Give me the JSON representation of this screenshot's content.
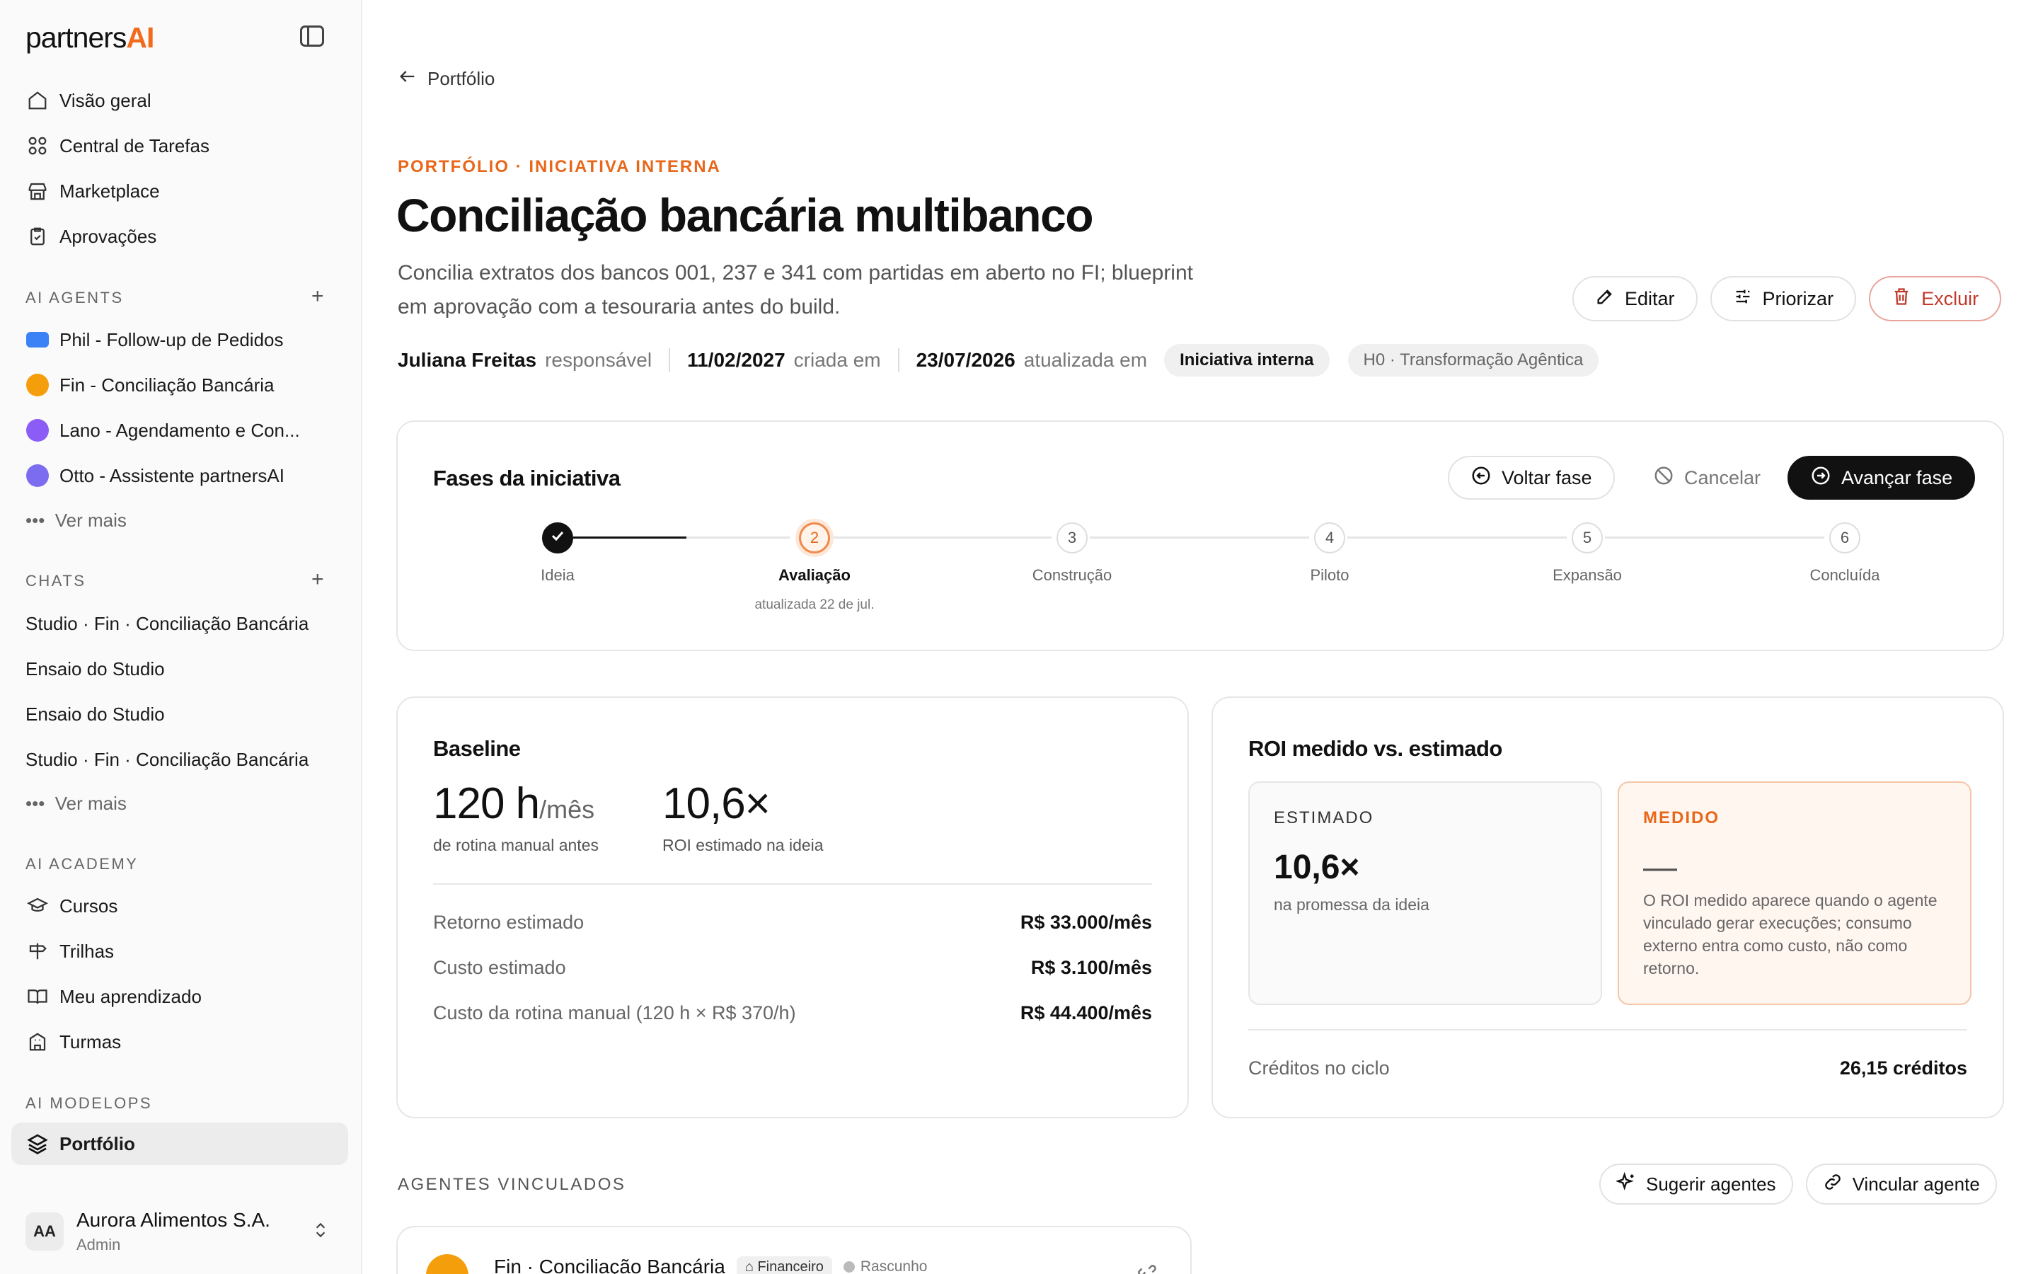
{
  "brand": {
    "main": "partners",
    "accent": "AI"
  },
  "sidebar": {
    "nav": [
      {
        "label": "Visão geral",
        "icon": "home-icon"
      },
      {
        "label": "Central de Tarefas",
        "icon": "grid-icon"
      },
      {
        "label": "Marketplace",
        "icon": "store-icon"
      },
      {
        "label": "Aprovações",
        "icon": "clipboard-check-icon"
      }
    ],
    "agents_title": "AI AGENTS",
    "agents": [
      {
        "label": "Phil - Follow-up de Pedidos",
        "color": "#3b82f6"
      },
      {
        "label": "Fin - Conciliação Bancária",
        "color": "#f59e0b"
      },
      {
        "label": "Lano - Agendamento e Con...",
        "color": "#8b5cf6"
      },
      {
        "label": "Otto - Assistente partnersAI",
        "color": "#7c6cf0"
      }
    ],
    "more": "Ver mais",
    "chats_title": "CHATS",
    "chats": [
      "Studio · Fin · Conciliação Bancária",
      "Ensaio do Studio",
      "Ensaio do Studio",
      "Studio · Fin · Conciliação Bancária"
    ],
    "academy_title": "AI ACADEMY",
    "academy": [
      {
        "label": "Cursos",
        "icon": "graduation-cap-icon"
      },
      {
        "label": "Trilhas",
        "icon": "signpost-icon"
      },
      {
        "label": "Meu aprendizado",
        "icon": "book-open-icon"
      },
      {
        "label": "Turmas",
        "icon": "building-icon"
      }
    ],
    "modelops_title": "AI MODELOPS",
    "modelops": [
      {
        "label": "Portfólio",
        "icon": "layers-icon"
      }
    ],
    "account": {
      "initials": "AA",
      "name": "Aurora Alimentos S.A.",
      "role": "Admin"
    }
  },
  "page": {
    "back": "Portfólio",
    "eyebrow": "PORTFÓLIO · INICIATIVA INTERNA",
    "title": "Conciliação bancária multibanco",
    "description": "Concilia extratos dos bancos 001, 237 e 341 com partidas em aberto no FI; blueprint em aprovação com a tesouraria antes do build.",
    "actions": {
      "edit": "Editar",
      "prioritize": "Priorizar",
      "delete": "Excluir"
    },
    "meta": {
      "owner": "Juliana Freitas",
      "owner_label": "responsável",
      "created": "11/02/2027",
      "created_label": "criada em",
      "updated": "23/07/2026",
      "updated_label": "atualizada em",
      "tag1": "Iniciativa interna",
      "tag2": "H0 · Transformação Agêntica"
    }
  },
  "phases": {
    "title": "Fases da iniciativa",
    "back": "Voltar fase",
    "cancel": "Cancelar",
    "advance": "Avançar fase",
    "steps": [
      {
        "n": "",
        "label": "Ideia"
      },
      {
        "n": "2",
        "label": "Avaliação",
        "sub": "atualizada 22 de jul."
      },
      {
        "n": "3",
        "label": "Construção"
      },
      {
        "n": "4",
        "label": "Piloto"
      },
      {
        "n": "5",
        "label": "Expansão"
      },
      {
        "n": "6",
        "label": "Concluída"
      }
    ]
  },
  "baseline": {
    "title": "Baseline",
    "hours": "120 h",
    "hours_unit": "/mês",
    "hours_label": "de rotina manual antes",
    "roi": "10,6×",
    "roi_label": "ROI estimado na ideia",
    "rows": [
      {
        "label": "Retorno estimado",
        "value": "R$ 33.000/mês"
      },
      {
        "label": "Custo estimado",
        "value": "R$ 3.100/mês"
      },
      {
        "label": "Custo da rotina manual (120 h × R$ 370/h)",
        "value": "R$ 44.400/mês"
      }
    ]
  },
  "roi": {
    "title": "ROI medido vs. estimado",
    "estimated": {
      "label": "ESTIMADO",
      "value": "10,6×",
      "desc": "na promessa da ideia"
    },
    "measured": {
      "label": "MEDIDO",
      "value": "—",
      "desc": "O ROI medido aparece quando o agente vinculado gerar execuções; consumo externo entra como custo, não como retorno."
    },
    "credits_label": "Créditos no ciclo",
    "credits_value": "26,15 créditos"
  },
  "agents_section": {
    "title": "AGENTES VINCULADOS",
    "suggest": "Sugerir agentes",
    "link": "Vincular agente",
    "items": [
      {
        "name": "Fin · Conciliação Bancária",
        "badge": "Financeiro",
        "status": "Rascunho"
      }
    ]
  },
  "colors": {
    "accent": "#f26b1d",
    "danger": "#c0392b"
  }
}
